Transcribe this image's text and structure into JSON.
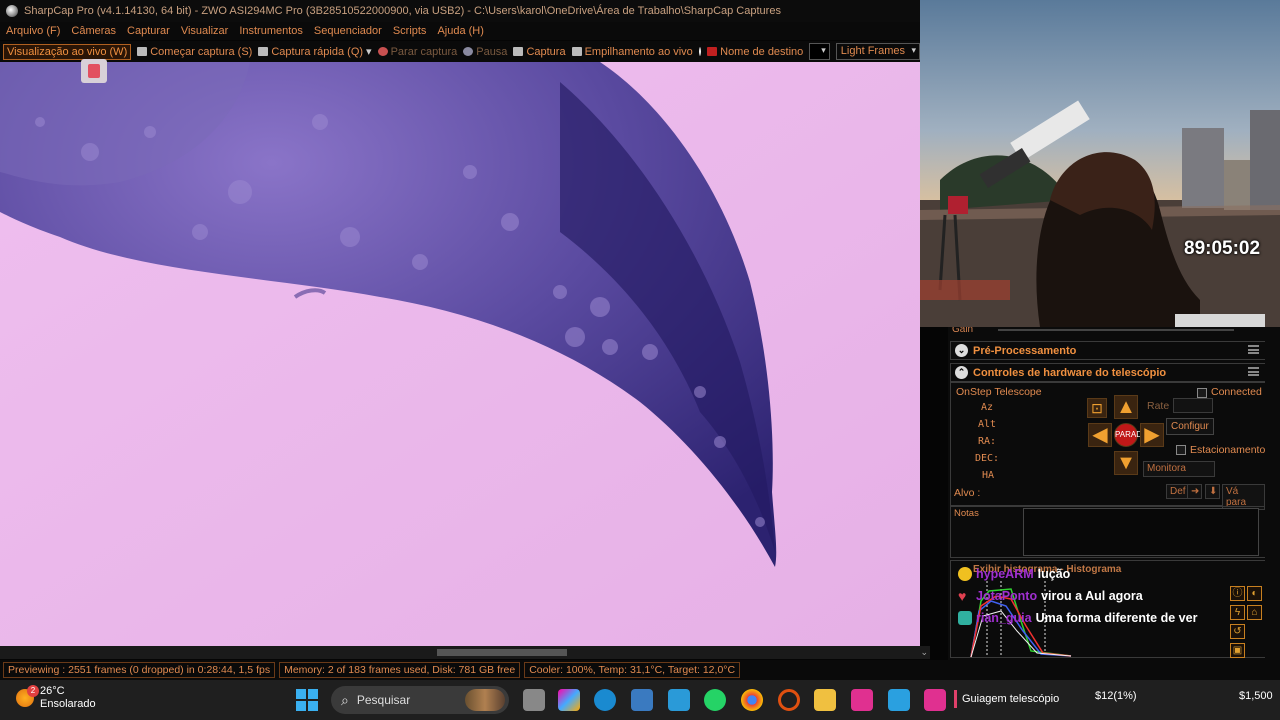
{
  "window": {
    "title": "SharpCap Pro (v4.1.14130, 64 bit) - ZWO ASI294MC Pro (3B28510522000900, via USB2) - C:\\Users\\karol\\OneDrive\\Área de Trabalho\\SharpCap Captures"
  },
  "menu": [
    "Arquivo (F)",
    "Câmeras",
    "Capturar",
    "Visualizar",
    "Instrumentos",
    "Sequenciador",
    "Scripts",
    "Ajuda (H)"
  ],
  "toolbar": {
    "live_view": "Visualização ao vivo (W)",
    "start_capture": "Começar captura (S)",
    "quick_capture": "Captura rápida (Q)",
    "stop_capture": "Parar captura",
    "pause": "Pausa",
    "snapshot": "Captura",
    "live_stack": "Empilhamento ao vivo",
    "target_name": "Nome de destino",
    "target_value": "",
    "frame_type": "Light Frames"
  },
  "status": {
    "preview": "Previewing : 2551 frames (0 dropped) in 0:28:44, 1,5 fps",
    "memory": "Memory: 2 of 183 frames used, Disk: 781 GB free",
    "cooler": "Cooler: 100%, Temp: 31,1°C, Target: 12,0°C"
  },
  "panel": {
    "gain_label": "Gain",
    "preprocessing": "Pré-Processamento",
    "telescope_controls": "Controles de hardware do telescópio",
    "telescope": {
      "name": "OnStep Telescope",
      "connected": "Connected",
      "az": "Az",
      "alt": "Alt",
      "ra": "RA:",
      "dec": "DEC:",
      "ha": "HA",
      "rate": "Rate",
      "configure": "Configur",
      "park": "Estacionamento",
      "stop_label": "PARAD",
      "monitor": "Monitora",
      "target_label": "Alvo :",
      "def": "Def",
      "goto": "Vá para"
    },
    "notes": "Notas",
    "histogram": "Exibir histograma - Histograma"
  },
  "chat": [
    {
      "user": "hypeARM",
      "msg": "lução",
      "icon_color": "#f0c020"
    },
    {
      "user": "JotaPonto",
      "msg": "virou a Aul agora",
      "icon_color": "#e04050"
    },
    {
      "user": "rian_guia",
      "msg": "Uma forma diferente de ver",
      "icon_color": "#30b0a0"
    }
  ],
  "webcam": {
    "timer": "89:05:02"
  },
  "taskbar": {
    "temp": "26°C",
    "weather": "Ensolarado",
    "weather_badge": "2",
    "search": "Pesquisar",
    "active_app": "Guiagem telescópio",
    "ticker1": "$12(1%)",
    "ticker2": "$1,500"
  }
}
